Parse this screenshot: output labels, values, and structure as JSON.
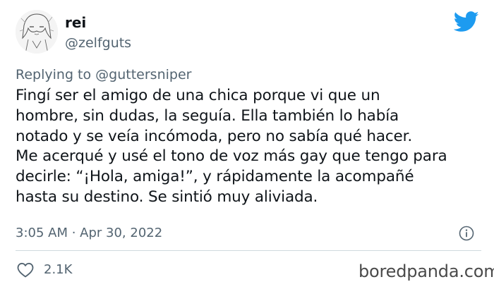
{
  "user": {
    "display_name": "rei",
    "handle": "@zelfguts"
  },
  "reply": {
    "prefix": "Replying to",
    "mention": "@guttersniper"
  },
  "tweet": {
    "lines": [
      "Fingí ser el amigo de una chica porque vi que un",
      "hombre, sin dudas, la seguía. Ella también lo había",
      "notado y se veía incómoda, pero no sabía qué hacer.",
      "Me acerqué y usé el tono de voz más gay que tengo para",
      "decirle: “¡Hola, amiga!”, y rápidamente la acompañé",
      "hasta su destino. Se sintió muy aliviada."
    ],
    "timestamp": "3:05 AM · Apr 30, 2022"
  },
  "actions": {
    "like_count": "2.1K"
  },
  "watermark": "boredpanda.com",
  "icons": {
    "brand": "twitter-bird-icon",
    "info": "info-icon",
    "like": "heart-icon"
  },
  "colors": {
    "twitter_blue": "#1d9bf0",
    "secondary_text": "#536471",
    "primary_text": "#0f1419"
  }
}
